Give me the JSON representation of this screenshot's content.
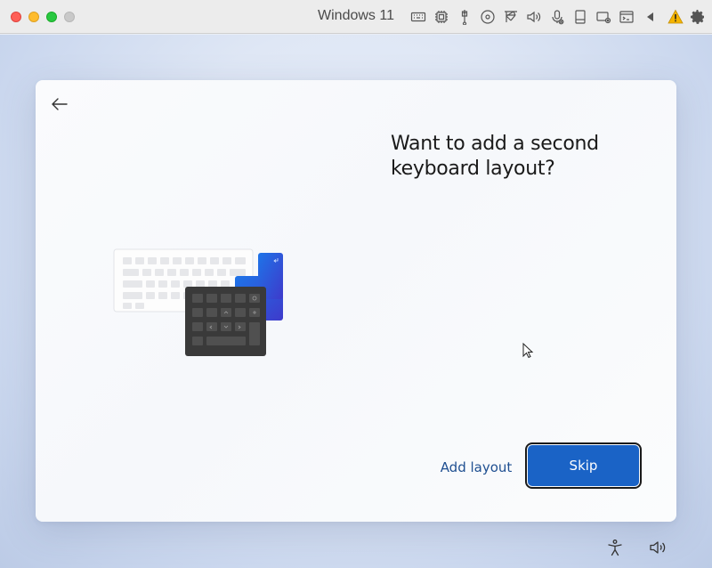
{
  "vm": {
    "title": "Windows 11",
    "toolbar_icons": [
      "keyboard-icon",
      "cpu-icon",
      "usb-icon",
      "optical-disc-icon",
      "network-icon",
      "audio-icon",
      "microphone-icon",
      "storage-icon",
      "display-icon",
      "terminal-icon",
      "play-icon",
      "warning-icon",
      "settings-gear-icon"
    ]
  },
  "oobe": {
    "heading": "Want to add a second keyboard layout?",
    "add_layout_label": "Add layout",
    "skip_label": "Skip"
  },
  "tray": {
    "icons": [
      "accessibility-icon",
      "volume-icon"
    ]
  },
  "colors": {
    "accent": "#1a63c6",
    "link": "#1f4f91",
    "warning": "#f5b400"
  }
}
